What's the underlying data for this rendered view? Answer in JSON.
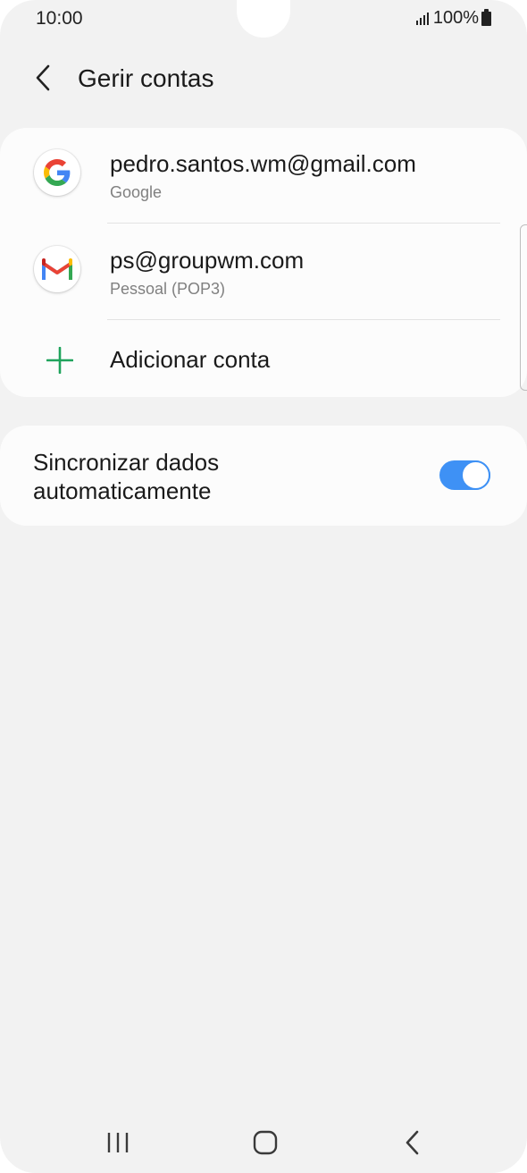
{
  "status_bar": {
    "time": "10:00",
    "battery_percent": "100%",
    "icons": [
      "signal-icon",
      "battery-icon"
    ]
  },
  "header": {
    "title": "Gerir contas",
    "back_icon": "chevron-left-icon"
  },
  "accounts": [
    {
      "email": "pedro.santos.wm@gmail.com",
      "type": "Google",
      "icon": "google-icon"
    },
    {
      "email": "ps@groupwm.com",
      "type": "Pessoal (POP3)",
      "icon": "gmail-icon"
    }
  ],
  "add_account": {
    "label": "Adicionar conta",
    "icon": "plus-icon",
    "accent_color": "#1fa35c"
  },
  "sync": {
    "label": "Sincronizar dados automaticamente",
    "enabled": true,
    "accent_color": "#3e91f5"
  },
  "nav_bar": {
    "icons": [
      "recents-icon",
      "home-icon",
      "back-icon"
    ]
  }
}
